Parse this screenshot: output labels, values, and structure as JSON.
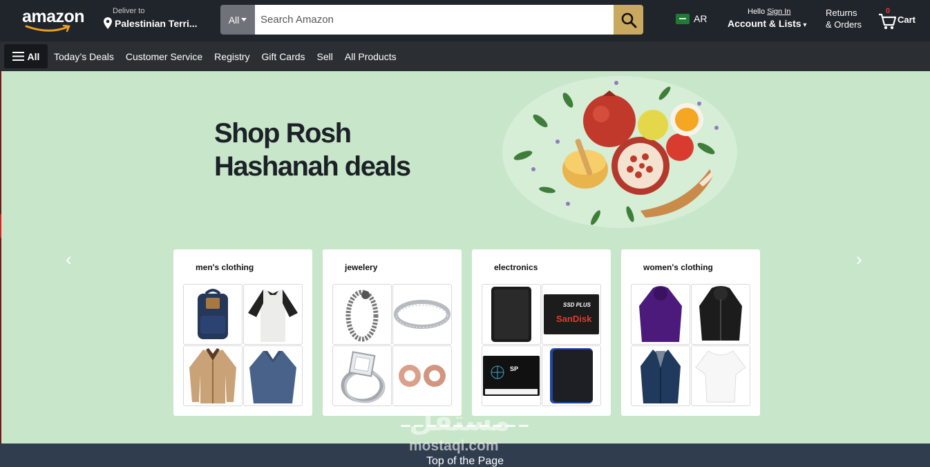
{
  "brand": {
    "logo_text": "amazon"
  },
  "header": {
    "deliver_small": "Deliver to",
    "deliver_location": "Palestinian Terri...",
    "search_category": "All",
    "search_placeholder": "Search Amazon",
    "language": "AR",
    "hello": "Hello",
    "sign_in": "Sign In",
    "account": "Account & Lists",
    "returns_line1": "Returns",
    "returns_line2": "& Orders",
    "cart_count": "0",
    "cart_label": "Cart"
  },
  "nav": {
    "all_label": "All",
    "links": [
      "Today’s Deals",
      "Customer Service",
      "Registry",
      "Gift Cards",
      "Sell",
      "All Products"
    ]
  },
  "hero": {
    "title": "Shop Rosh\nHashanah deals",
    "prev_arrow": "‹",
    "next_arrow": "›"
  },
  "cards": [
    {
      "title": "men's clothing",
      "items": [
        "backpack-icon",
        "raglan-tee-icon",
        "jacket-icon",
        "vneck-sweater-icon"
      ]
    },
    {
      "title": "jewelery",
      "items": [
        "dragon-bracelet-icon",
        "silver-bangle-icon",
        "diamond-ring-icon",
        "rose-gold-plugs-icon"
      ]
    },
    {
      "title": "electronics",
      "items": [
        "external-hdd-icon",
        "sandisk-ssd-icon",
        "sp-ssd-icon",
        "wd-portable-drive-icon"
      ]
    },
    {
      "title": "women's clothing",
      "items": [
        "purple-parka-icon",
        "black-leather-jacket-icon",
        "navy-coat-icon",
        "white-top-icon"
      ]
    }
  ],
  "watermark": {
    "arabic": "مستقل",
    "latin": "mostaqi.com"
  },
  "footer": {
    "top_of_page": "Top of the Page"
  },
  "colors": {
    "header_bg": "#20252b",
    "nav_bg": "#2b2f33",
    "search_button": "#c9a860",
    "hero_bg": "#c8e6c9",
    "footer_bg": "#2f3d4f"
  }
}
